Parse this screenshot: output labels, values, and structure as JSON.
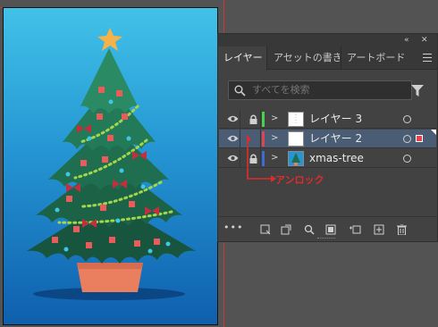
{
  "panel": {
    "tabs": [
      {
        "label": "レイヤー",
        "active": true
      },
      {
        "label": "アセットの書き出し",
        "active": false
      },
      {
        "label": "アートボード",
        "active": false
      }
    ],
    "topbar": {
      "collapse": "«",
      "close": "✕"
    },
    "menu_icon": "hamburger-menu-icon",
    "search": {
      "placeholder": "すべてを検索"
    },
    "layers": [
      {
        "name": "レイヤー 3",
        "color": "#46d24a",
        "locked": true,
        "visible": true,
        "selected": false
      },
      {
        "name": "レイヤー 2",
        "color": "#e2444d",
        "locked": false,
        "visible": true,
        "selected": true
      },
      {
        "name": "xmas-tree",
        "color": "#3b6bd6",
        "locked": true,
        "visible": true,
        "selected": false
      }
    ],
    "bottom_icons": [
      "more-icon",
      "collect-for-export-icon",
      "locate-object-icon",
      "search-zoom-icon",
      "clipping-mask-icon",
      "new-sublayer-icon",
      "new-layer-icon",
      "delete-icon"
    ]
  },
  "annotation": {
    "label": "アンロック",
    "color": "#e12b2b"
  },
  "artboard": {
    "gradient_top": "#41c2e8",
    "gradient_bottom": "#0f5fad"
  }
}
